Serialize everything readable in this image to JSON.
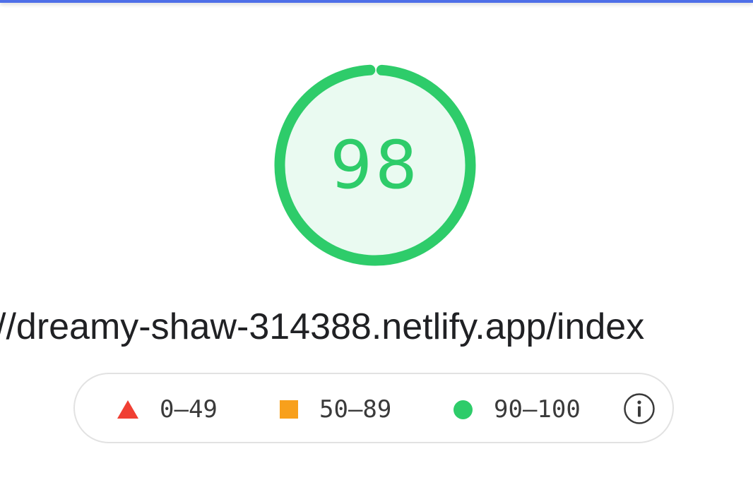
{
  "score": {
    "value": "98",
    "fraction": 0.98,
    "color": "#2ecc6a",
    "fill_color": "#eafaf1"
  },
  "url": {
    "text": "//dreamy-shaw-314388.netlify.app/index"
  },
  "legend": {
    "items": [
      {
        "range": "0–49",
        "icon": "red-triangle-icon",
        "color": "#f03f33"
      },
      {
        "range": "50–89",
        "icon": "orange-square-icon",
        "color": "#f8a01c"
      },
      {
        "range": "90–100",
        "icon": "green-circle-icon",
        "color": "#2ecc6a"
      }
    ],
    "info_icon": "info-icon"
  },
  "theme": {
    "top_bar_color": "#4f6fe8"
  }
}
